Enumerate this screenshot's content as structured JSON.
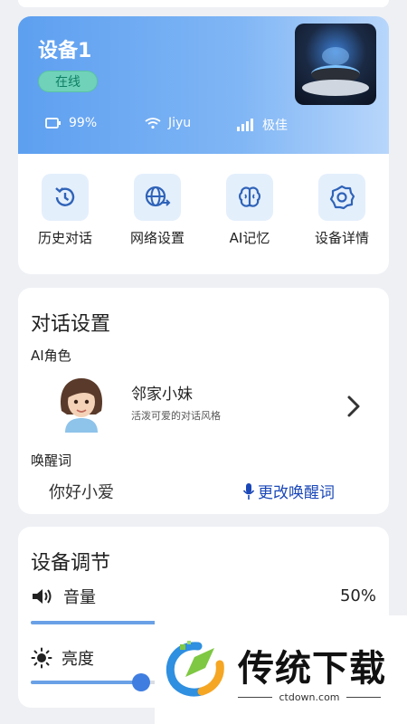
{
  "device": {
    "name": "设备1",
    "status": "在线",
    "battery": "99%",
    "wifi": "Jiyu",
    "signal": "极佳"
  },
  "quick_actions": [
    {
      "label": "历史对话",
      "icon": "history-icon"
    },
    {
      "label": "网络设置",
      "icon": "network-globe-icon"
    },
    {
      "label": "AI记忆",
      "icon": "brain-icon"
    },
    {
      "label": "设备详情",
      "icon": "gear-icon"
    }
  ],
  "dialog_settings": {
    "title": "对话设置",
    "role_label": "AI角色",
    "role_name": "邻家小妹",
    "role_desc": "活泼可爱的对话风格",
    "wake_label": "唤醒词",
    "wake_word": "你好小爱",
    "change_wake": "更改唤醒词"
  },
  "device_adjust": {
    "title": "设备调节",
    "volume_label": "音量",
    "volume_value": "50%",
    "volume_level": 0.5,
    "brightness_label": "亮度",
    "brightness_level": 0.32
  },
  "watermark": {
    "text": "传统下载",
    "url": "ctdown.com"
  },
  "colors": {
    "header_gradient_start": "#5d9ff0",
    "online_badge": "#6fd2b9",
    "accent_blue": "#3f7de0",
    "link_blue": "#1a47b8"
  }
}
